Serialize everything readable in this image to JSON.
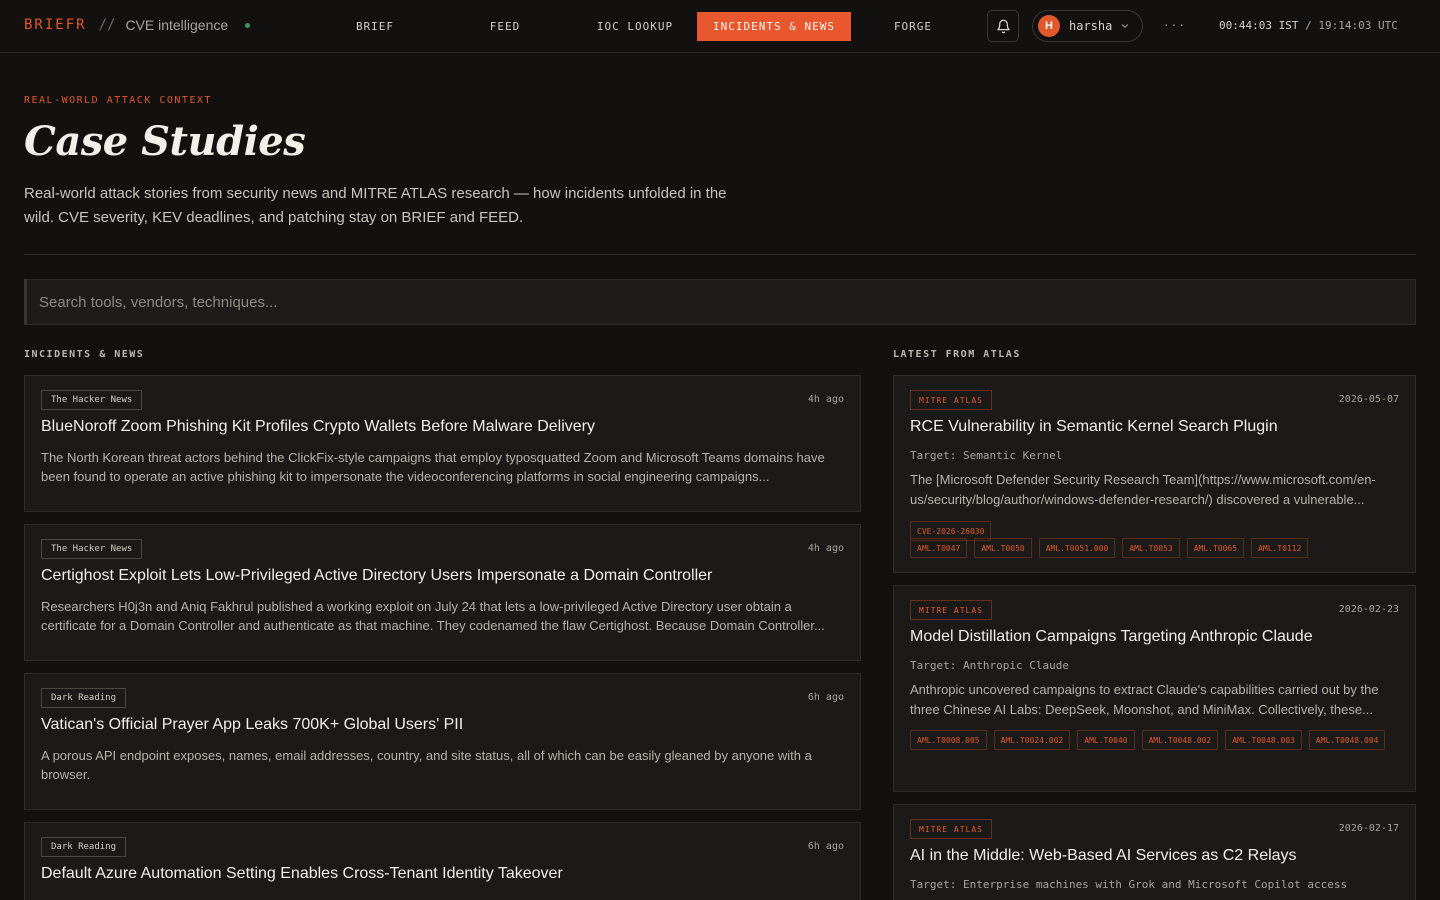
{
  "brand": {
    "name": "BRIEFR",
    "separator": "//",
    "tagline": "CVE intelligence",
    "status_color": "#3c9a56",
    "accent": "#e2572b"
  },
  "nav": {
    "items": [
      {
        "label": "BRIEF"
      },
      {
        "label": "FEED"
      },
      {
        "label": "IOC LOOKUP"
      },
      {
        "label": "INCIDENTS & NEWS",
        "active": true
      },
      {
        "label": "FORGE"
      }
    ]
  },
  "header": {
    "bell_icon": "bell-icon",
    "user": {
      "initial": "H",
      "name": "harsha",
      "icon": "chevron-down-icon"
    },
    "more_label": "···",
    "clock": {
      "ist": "00:44:03 IST",
      "sep": " / ",
      "utc": "19:14:03 UTC"
    }
  },
  "hero": {
    "eyebrow": "REAL-WORLD ATTACK CONTEXT",
    "title": "Case Studies",
    "intro": "Real-world attack stories from security news and MITRE ATLAS research — how incidents unfolded in the wild. CVE severity, KEV deadlines, and patching stay on BRIEF and FEED."
  },
  "search": {
    "placeholder": "Search tools, vendors, techniques..."
  },
  "incidents": {
    "label": "INCIDENTS & NEWS",
    "items": [
      {
        "source": "The Hacker News",
        "time": "4h ago",
        "title": "BlueNoroff Zoom Phishing Kit Profiles Crypto Wallets Before Malware Delivery",
        "body": "The North Korean threat actors behind the ClickFix-style campaigns that employ typosquatted Zoom and Microsoft Teams domains have been found to operate an active phishing kit to impersonate the videoconferencing platforms in social engineering campaigns..."
      },
      {
        "source": "The Hacker News",
        "time": "4h ago",
        "title": "Certighost Exploit Lets Low-Privileged Active Directory Users Impersonate a Domain Controller",
        "body": "Researchers H0j3n and Aniq Fakhrul published a working exploit on July 24 that lets a low-privileged Active Directory user obtain a certificate for a Domain Controller and authenticate as that machine. They codenamed the flaw Certighost. Because Domain Controller..."
      },
      {
        "source": "Dark Reading",
        "time": "6h ago",
        "title": "Vatican's Official Prayer App Leaks 700K+ Global Users' PII",
        "body": "A porous API endpoint exposes, names, email addresses, country, and site status, all of which can be easily gleaned by anyone with a browser."
      },
      {
        "source": "Dark Reading",
        "time": "6h ago",
        "title": "Default Azure Automation Setting Enables Cross-Tenant Identity Takeover",
        "body": ""
      }
    ]
  },
  "atlas": {
    "label": "LATEST FROM ATLAS",
    "items": [
      {
        "badge": "MITRE ATLAS",
        "date": "2026-05-07",
        "title": "RCE Vulnerability in Semantic Kernel Search Plugin",
        "target": "Target: Semantic Kernel",
        "body": "The [Microsoft Defender Security Research Team](https://www.microsoft.com/en-us/security/blog/author/windows-defender-research/) discovered a vulnerable...",
        "cve_tags": [
          "CVE-2026-26030"
        ],
        "tags": [
          "AML.T0047",
          "AML.T0050",
          "AML.T0051.000",
          "AML.T0053",
          "AML.T0065",
          "AML.T0112"
        ]
      },
      {
        "badge": "MITRE ATLAS",
        "date": "2026-02-23",
        "title": "Model Distillation Campaigns Targeting Anthropic Claude",
        "target": "Target: Anthropic Claude",
        "body": "Anthropic uncovered campaigns to extract Claude's capabilities carried out by the three Chinese AI Labs: DeepSeek, Moonshot, and MiniMax. Collectively, these...",
        "cve_tags": [],
        "tags": [
          "AML.T0008.005",
          "AML.T0024.002",
          "AML.T0040",
          "AML.T0048.002",
          "AML.T0048.003",
          "AML.T0048.004"
        ]
      },
      {
        "badge": "MITRE ATLAS",
        "date": "2026-02-17",
        "title": "AI in the Middle: Web-Based AI Services as C2 Relays",
        "target": "Target: Enterprise machines with Grok and Microsoft Copilot access",
        "body": "",
        "cve_tags": [],
        "tags": []
      }
    ]
  }
}
